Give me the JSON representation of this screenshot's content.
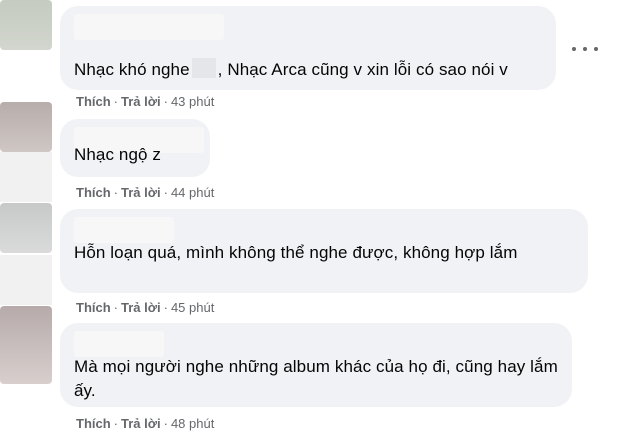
{
  "comments": [
    {
      "text_before": "Nhạc khó nghe",
      "text_after": ", Nhạc Arca cũng v xin lỗi có sao nói v",
      "like_label": "Thích",
      "reply_label": "Trả lời",
      "time": "43 phút"
    },
    {
      "text": "Nhạc ngộ z",
      "like_label": "Thích",
      "reply_label": "Trả lời",
      "time": "44 phút"
    },
    {
      "text": "Hỗn loạn quá, mình không thể nghe được, không hợp lắm",
      "like_label": "Thích",
      "reply_label": "Trả lời",
      "time": "45 phút"
    },
    {
      "text": "Mà mọi người nghe những album khác của họ đi, cũng hay lắm ấy.",
      "like_label": "Thích",
      "reply_label": "Trả lời",
      "time": "48 phút"
    }
  ],
  "separator": "·",
  "icons": {
    "more": "more-options-icon"
  },
  "colors": {
    "bubble": "#f0f2f5",
    "text": "#050505",
    "meta": "#65676b"
  }
}
